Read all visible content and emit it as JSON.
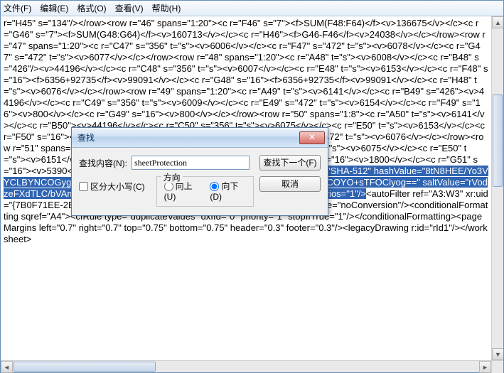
{
  "menu": {
    "file": "文件(F)",
    "edit": "编辑(E)",
    "format": "格式(O)",
    "view": "查看(V)",
    "help": "帮助(H)"
  },
  "text": {
    "before": "r=\"H45\" s=\"134\"/></row><row r=\"46\" spans=\"1:20\"><c r=\"F46\" s=\"7\"><f>SUM(F48:F64)</f><v>136675</v></c><c r=\"G46\" s=\"7\"><f>SUM(G48:G64)</f><v>160713</v></c><c r=\"H46\"><f>G46-F46</f><v>24038</v></c></row><row r=\"47\" spans=\"1:20\"><c r=\"C47\" s=\"356\" t=\"s\"><v>6006</v></c><c r=\"F47\" s=\"472\" t=\"s\"><v>6078</v></c><c r=\"G47\" s=\"472\" t=\"s\"><v>6077</v></c></row><row r=\"48\" spans=\"1:20\"><c r=\"A48\" t=\"s\"><v>6008</v></c><c r=\"B48\" s=\"426\"/><v>44196</v></c><c r=\"C48\" s=\"356\" t=\"s\"><v>6007</v></c><c r=\"E48\" t=\"s\"><v>6153</v></c><c r=\"F48\" s=\"16\"><f>6356+92735</f><v>99091</v></c><c r=\"G48\" s=\"16\"><f>6356+92735</f><v>99091</v></c><c r=\"H48\" t=\"s\"><v>6076</v></c></row><row r=\"49\" spans=\"1:20\"><c r=\"A49\" t=\"s\"><v>6141</v></c><c r=\"B49\" s=\"426\"><v>44196</v></c><c r=\"C49\" s=\"356\" t=\"s\"><v>6009</v></c><c r=\"E49\" s=\"472\" t=\"s\"><v>6154</v></c><c r=\"F49\" s=\"16\"><v>800</v></c><c r=\"G49\" s=\"16\"><v>800</v></c></row><row r=\"50\" spans=\"1:8\"><c r=\"A50\" t=\"s\"><v>6141</v></c><c r=\"B50\"><v>44196</v></c><c r=\"C50\" s=\"356\" t=\"s\"><v>6075</v></c><c r=\"E50\" t=\"s\"><v>6153</v></c><c r=\"F50\" s=\"16\"><v>6150</v></c><c r=\"G50\"><v>6150</v></c><c r=\"H50\" s=\"472\" t=\"s\"><v>6076</v></c></row><row r=\"51\" spans=\"1:8\"><c r=\"C51\" t=\"s\"><v>6141</v></c><c r=\"C51\" s=\"356\" t=\"s\"><v>6075</v></c><c r=\"E50\" t=\"s\"><v>6151</v></c><c r=\"E51\" s=\"472\" t=\"s\"><v>6153</v></c><c r=\"F51\" s=\"16\"><v>1800</v></c><c r=\"G51\" s=\"16\"><v>5390</v></c></row></sheetData>",
    "selected": "<sheetProtection algorithmName=\"SHA-512\" hashValue=\"8tN8HEE/Yo3VYCLBYNCOGygEuctxE+RhirZ7z01/Xgf8FvOC/Bk9twW+A4HVIqmQjoUQx09MCOYO+sTFOClyog==\" saltValue=\"rVodzeFXdTLC/bVAmTHbmw==\" spinCount=\"100000\" sheet=\"1\" objects=\"1\" scenarios=\"1\"/>",
    "after": "<autoFilter ref=\"A3:W3\" xr:uid=\"{7B0F71EE-2EC9-47D9-A546-32C2DF82290E}\"/><phoneticPr fontId=\"4\" type=\"noConversion\"/><conditionalFormatting sqref=\"A4\"><cfRule type=\"duplicateValues\" dxfId=\"0\" priority=\"1\" stopIfTrue=\"1\"/></conditionalFormatting><pageMargins left=\"0.7\" right=\"0.7\" top=\"0.75\" bottom=\"0.75\" header=\"0.3\" footer=\"0.3\"/><legacyDrawing r:id=\"rId1\"/></worksheet>"
  },
  "dialog": {
    "title": "查找",
    "label": "查找内容(N):",
    "value": "sheetProtection",
    "findNext": "查找下一个(F)",
    "cancel": "取消",
    "matchCase": "区分大小写(C)",
    "dirLegend": "方向",
    "up": "向上(U)",
    "down": "向下(D)"
  }
}
